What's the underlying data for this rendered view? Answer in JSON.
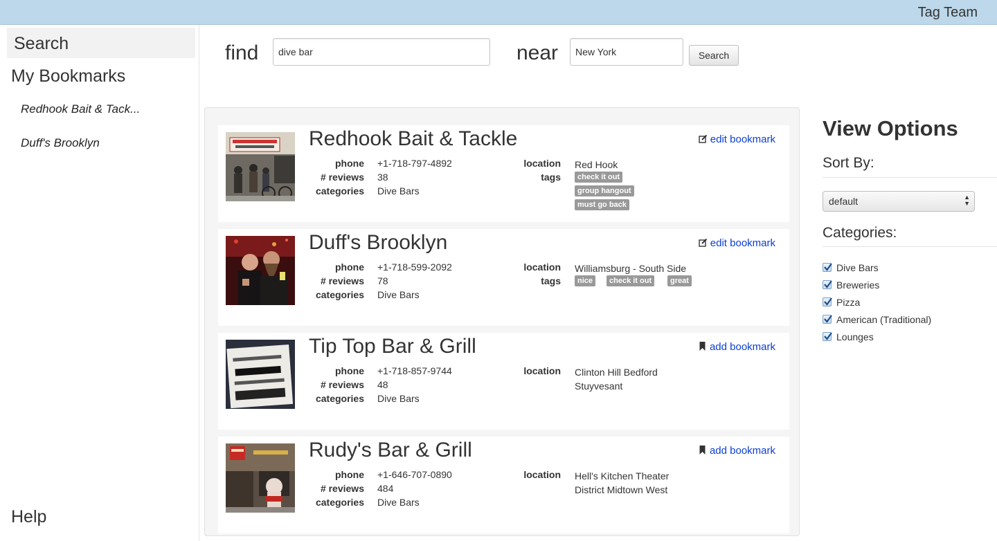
{
  "header": {
    "brand": "Tag Team"
  },
  "sidebar": {
    "search_label": "Search",
    "bookmarks_label": "My Bookmarks",
    "bookmarks": [
      "Redhook Bait & Tack...",
      "Duff's Brooklyn"
    ],
    "help_label": "Help"
  },
  "search": {
    "find_label": "find",
    "find_value": "dive bar",
    "near_label": "near",
    "near_value": "New York",
    "button_label": "Search"
  },
  "labels": {
    "phone": "phone",
    "reviews": "# reviews",
    "categories": "categories",
    "location": "location",
    "tags": "tags"
  },
  "results": [
    {
      "name": "Redhook Bait & Tackle",
      "action": "edit bookmark",
      "action_icon": "edit-icon",
      "phone": "+1-718-797-4892",
      "reviews": "38",
      "categories": "Dive Bars",
      "location": [
        "Red Hook"
      ],
      "tags": [
        "check it out",
        "group hangout",
        "must go back"
      ]
    },
    {
      "name": "Duff's Brooklyn",
      "action": "edit bookmark",
      "action_icon": "edit-icon",
      "phone": "+1-718-599-2092",
      "reviews": "78",
      "categories": "Dive Bars",
      "location": [
        "Williamsburg - South Side"
      ],
      "tags": [
        "nice",
        "check it out",
        "great"
      ]
    },
    {
      "name": "Tip Top Bar & Grill",
      "action": "add bookmark",
      "action_icon": "bookmark-icon",
      "phone": "+1-718-857-9744",
      "reviews": "48",
      "categories": "Dive Bars",
      "location": [
        "Clinton Hill Bedford",
        "Stuyvesant"
      ],
      "tags": []
    },
    {
      "name": "Rudy's Bar & Grill",
      "action": "add bookmark",
      "action_icon": "bookmark-icon",
      "phone": "+1-646-707-0890",
      "reviews": "484",
      "categories": "Dive Bars",
      "location": [
        "Hell's Kitchen Theater",
        "District Midtown West"
      ],
      "tags": []
    }
  ],
  "view_options": {
    "title": "View Options",
    "sort_label": "Sort By:",
    "sort_value": "default",
    "categories_label": "Categories:",
    "categories": [
      {
        "label": "Dive Bars",
        "checked": true
      },
      {
        "label": "Breweries",
        "checked": true
      },
      {
        "label": "Pizza",
        "checked": true
      },
      {
        "label": "American (Traditional)",
        "checked": true
      },
      {
        "label": "Lounges",
        "checked": true
      }
    ]
  },
  "colors": {
    "topbar": "#bcd8ea",
    "link": "#0a3fcf",
    "tag_bg": "#999999"
  }
}
